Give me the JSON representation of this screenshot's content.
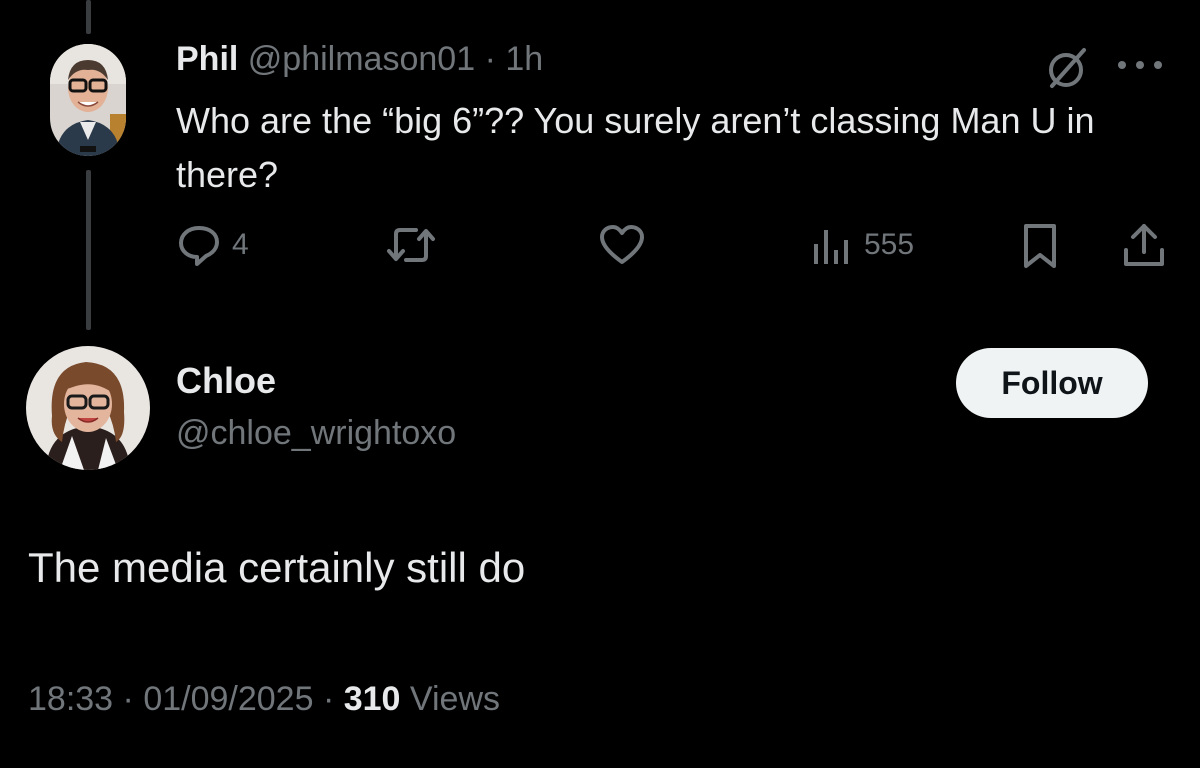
{
  "reply": {
    "name": "Phil",
    "handle": "@philmason01",
    "separator": "·",
    "time": "1h",
    "text": "Who are the “big 6”?? You surely aren’t classing Man U in there?",
    "actions": {
      "reply_icon": "reply-icon",
      "reply_count": "4",
      "repost_icon": "repost-icon",
      "like_icon": "heart-icon",
      "views_icon": "views-icon",
      "views_count": "555",
      "bookmark_icon": "bookmark-icon",
      "share_icon": "share-icon"
    },
    "more_icon": "more-icon",
    "grok_icon": "grok-icon"
  },
  "tweet": {
    "name": "Chloe",
    "handle": "@chloe_wrightoxo",
    "follow_label": "Follow",
    "text": "The media certainly still do",
    "time": "18:33",
    "separator": "·",
    "date": "01/09/2025",
    "views_count": "310",
    "views_label": "Views"
  },
  "colors": {
    "background": "#000000",
    "text": "#e7e9ea",
    "muted": "#71767b",
    "follow_bg": "#eff3f4",
    "thread_line": "#3a3d40"
  }
}
